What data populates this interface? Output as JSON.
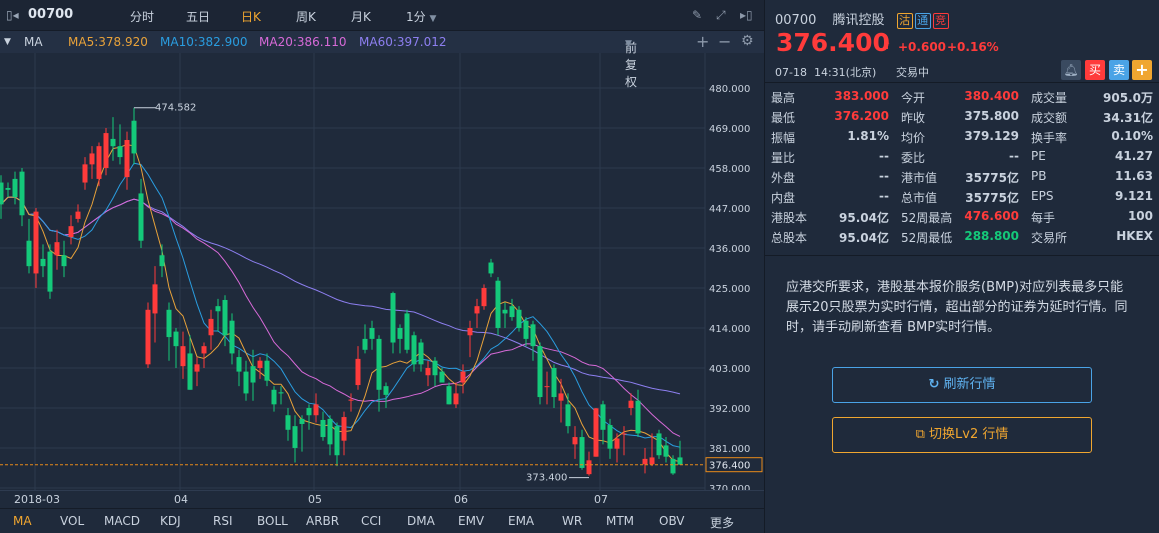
{
  "toolbar": {
    "code": "00700",
    "periods": [
      "分时",
      "五日",
      "日K",
      "周K",
      "月K",
      "1分"
    ],
    "active_period": "日K"
  },
  "ma_bar": {
    "name": "MA",
    "ma5": "MA5:378.920",
    "ma10": "MA10:382.900",
    "ma20": "MA20:386.110",
    "ma60": "MA60:397.012",
    "adjust": "前复权"
  },
  "colors": {
    "up": "#ff3b3b",
    "down": "#14c97a",
    "ma5": "#e8a23a",
    "ma10": "#2a9de0",
    "ma20": "#d76ad8",
    "ma60": "#8d7ff0",
    "last": "#e88a1a"
  },
  "chart_data": {
    "type": "candlestick",
    "ylim": [
      368,
      483
    ],
    "y_ticks": [
      "480.000",
      "469.000",
      "458.000",
      "447.000",
      "436.000",
      "425.000",
      "414.000",
      "403.000",
      "392.000",
      "381.000",
      "370.000"
    ],
    "last_price_label": "376.400",
    "max_label": "474.582",
    "min_label": "373.400",
    "x_labels": [
      "2018-03",
      "04",
      "05",
      "06",
      "07"
    ],
    "ohlc": [
      [
        454,
        456,
        444,
        448
      ],
      [
        452.5,
        454,
        450,
        452
      ],
      [
        455,
        457,
        448,
        450
      ],
      [
        457,
        458,
        442,
        445
      ],
      [
        438,
        444,
        429,
        431
      ],
      [
        429,
        447,
        425,
        446
      ],
      [
        433,
        437,
        428,
        431
      ],
      [
        435,
        437,
        422,
        424
      ],
      [
        434,
        441,
        430,
        437.6
      ],
      [
        434,
        438,
        428,
        431
      ],
      [
        439,
        445,
        437,
        442
      ],
      [
        444,
        448,
        443,
        446
      ],
      [
        454,
        461,
        452,
        459
      ],
      [
        459,
        464,
        455,
        462
      ],
      [
        455,
        465,
        453,
        464
      ],
      [
        458,
        469,
        456,
        467.6
      ],
      [
        466,
        472,
        460,
        464
      ],
      [
        464,
        470,
        459,
        461
      ],
      [
        455.5,
        468,
        452,
        465.7
      ],
      [
        471,
        474.582,
        459,
        462
      ],
      [
        451,
        455,
        436,
        438
      ],
      [
        404,
        421,
        403,
        419
      ],
      [
        418,
        431,
        410,
        426
      ],
      [
        434,
        437,
        428,
        431
      ],
      [
        419,
        421,
        405,
        411.5
      ],
      [
        413,
        414,
        403,
        409
      ],
      [
        403.5,
        413,
        400,
        409
      ],
      [
        407,
        412,
        397,
        397
      ],
      [
        402,
        406,
        398,
        404
      ],
      [
        407,
        410,
        403,
        409
      ],
      [
        412,
        419,
        408,
        416.5
      ],
      [
        420,
        422,
        413,
        418.6
      ],
      [
        421.7,
        423,
        409,
        412
      ],
      [
        416,
        418,
        404,
        407
      ],
      [
        406,
        408,
        398,
        402
      ],
      [
        402,
        405,
        394,
        396
      ],
      [
        403.5,
        408,
        394,
        399
      ],
      [
        403,
        406,
        400,
        405
      ],
      [
        405,
        407,
        398,
        399.5
      ],
      [
        397,
        398,
        391,
        393
      ],
      [
        396.3,
        398,
        393,
        396
      ],
      [
        390,
        392,
        383,
        386
      ],
      [
        387,
        390,
        377,
        381
      ],
      [
        389,
        390,
        380,
        387.6
      ],
      [
        392,
        393,
        386,
        390
      ],
      [
        390,
        396,
        388,
        393
      ],
      [
        388.7,
        391,
        383,
        384
      ],
      [
        389,
        390,
        379,
        382
      ],
      [
        387,
        388,
        376,
        379
      ],
      [
        383,
        391,
        379,
        389.5
      ],
      [
        394,
        396,
        391,
        394.3
      ],
      [
        398.3,
        409,
        397,
        405.5
      ],
      [
        411,
        415,
        407,
        408
      ],
      [
        414,
        416,
        408,
        411
      ],
      [
        411,
        412,
        391,
        397
      ],
      [
        398,
        399,
        392,
        395.6
      ],
      [
        423.6,
        424,
        407,
        410
      ],
      [
        414,
        415,
        407,
        411
      ],
      [
        418,
        419,
        407,
        408
      ],
      [
        412,
        413,
        402,
        404
      ],
      [
        410,
        411,
        402,
        404
      ],
      [
        401,
        405,
        398,
        403
      ],
      [
        405,
        406,
        398,
        401
      ],
      [
        402,
        403,
        399,
        399
      ],
      [
        398,
        399,
        393,
        393
      ],
      [
        393,
        399,
        392,
        396
      ],
      [
        399,
        404,
        396,
        402
      ],
      [
        412,
        416,
        406,
        414
      ],
      [
        418,
        422,
        414,
        420
      ],
      [
        420,
        426,
        419,
        425
      ],
      [
        432,
        433,
        428,
        429
      ],
      [
        427,
        428,
        412,
        414
      ],
      [
        419,
        421,
        414,
        418
      ],
      [
        420,
        422,
        416,
        417
      ],
      [
        419,
        420,
        413,
        414
      ],
      [
        416,
        417,
        409,
        411
      ],
      [
        415,
        416,
        405,
        409
      ],
      [
        409,
        410,
        393,
        395
      ],
      [
        397.8,
        402,
        393,
        398
      ],
      [
        403,
        404,
        392,
        395
      ],
      [
        394,
        400,
        388,
        396
      ],
      [
        393,
        396,
        385,
        387
      ],
      [
        382,
        387,
        378,
        384
      ],
      [
        384,
        386,
        375,
        375.5
      ],
      [
        373.8,
        380,
        373.4,
        377.6
      ],
      [
        378.6,
        392,
        378.6,
        391.9
      ],
      [
        393,
        394,
        382,
        386
      ],
      [
        387.3,
        389,
        378,
        380.8
      ],
      [
        380.8,
        385,
        377,
        383.6
      ],
      [
        385,
        387,
        379,
        385
      ],
      [
        392,
        396,
        390,
        394
      ],
      [
        394,
        397,
        384,
        385
      ],
      [
        376.5,
        381,
        374,
        378
      ],
      [
        376.5,
        385,
        376,
        378.4
      ],
      [
        385,
        386,
        378,
        379
      ],
      [
        381.7,
        384,
        377,
        378.6
      ],
      [
        378,
        379,
        373.6,
        374
      ],
      [
        378.4,
        383,
        376.4,
        376.4
      ]
    ]
  },
  "indicator_tabs": [
    "MA",
    "VOL",
    "MACD",
    "KDJ",
    "RSI",
    "BOLL",
    "ARBR",
    "CCI",
    "DMA",
    "EMV",
    "EMA",
    "WR",
    "MTM",
    "OBV",
    "更多"
  ],
  "quote": {
    "code": "00700",
    "name": "腾讯控股",
    "badges": [
      "沽",
      "通",
      "竞"
    ],
    "price": "376.400",
    "change": "+0.600",
    "change_pct": "+0.16%",
    "time": "07-18  14:31(北京)",
    "status": "交易中",
    "buy": "买",
    "sell": "卖",
    "add": "+"
  },
  "stats": [
    [
      [
        "最高",
        "383.000",
        "red"
      ],
      [
        "今开",
        "380.400",
        "red"
      ],
      [
        "成交量",
        "905.0万",
        ""
      ]
    ],
    [
      [
        "最低",
        "376.200",
        "red"
      ],
      [
        "昨收",
        "375.800",
        ""
      ],
      [
        "成交额",
        "34.31亿",
        ""
      ]
    ],
    [
      [
        "振幅",
        "1.81%",
        ""
      ],
      [
        "均价",
        "379.129",
        ""
      ],
      [
        "换手率",
        "0.10%",
        ""
      ]
    ],
    [
      [
        "量比",
        "--",
        ""
      ],
      [
        "委比",
        "--",
        ""
      ],
      [
        "PE",
        "41.27",
        ""
      ]
    ],
    [
      [
        "外盘",
        "--",
        ""
      ],
      [
        "港市值",
        "35775亿",
        ""
      ],
      [
        "PB",
        "11.63",
        ""
      ]
    ],
    [
      [
        "内盘",
        "--",
        ""
      ],
      [
        "总市值",
        "35775亿",
        ""
      ],
      [
        "EPS",
        "9.121",
        ""
      ]
    ],
    [
      [
        "港股本",
        "95.04亿",
        ""
      ],
      [
        "52周最高",
        "476.600",
        "red"
      ],
      [
        "每手",
        "100",
        ""
      ]
    ],
    [
      [
        "总股本",
        "95.04亿",
        ""
      ],
      [
        "52周最低",
        "288.800",
        "green"
      ],
      [
        "交易所",
        "HKEX",
        ""
      ]
    ]
  ],
  "notice": "应港交所要求，港股基本报价服务(BMP)对应列表最多只能展示20只股票为实时行情，超出部分的证券为延时行情。同时，请手动刷新查看 BMP实时行情。",
  "buttons": {
    "refresh": "刷新行情",
    "switch": "切换Lv2 行情"
  }
}
